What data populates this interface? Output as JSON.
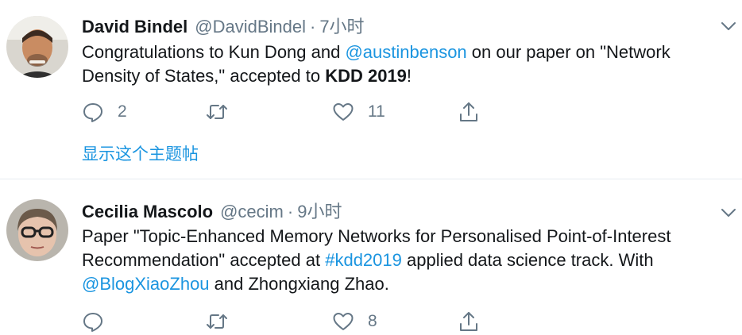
{
  "colors": {
    "link": "#1b95e0",
    "muted": "#657786",
    "text": "#14171a",
    "divider": "#e6ecf0"
  },
  "tweets": [
    {
      "name": "David Bindel",
      "handle": "@DavidBindel",
      "dot": "·",
      "time": "7小时",
      "text": {
        "p1": "Congratulations to Kun Dong and ",
        "mention": "@austinbenson",
        "p2": " on our paper on \"Network Density of States,\" accepted to ",
        "bold": "KDD 2019",
        "p3": "!"
      },
      "actions": {
        "reply_count": "2",
        "retweet_count": "",
        "like_count": "11"
      },
      "show_thread": "显示这个主题帖",
      "icons": {
        "reply": "reply-icon",
        "retweet": "retweet-icon",
        "like": "heart-icon",
        "share": "share-icon",
        "menu": "chevron-down-icon"
      }
    },
    {
      "name": "Cecilia Mascolo",
      "handle": "@cecim",
      "dot": "·",
      "time": "9小时",
      "text": {
        "p1": "Paper \"Topic-Enhanced Memory Networks for Personalised Point-of-Interest Recommendation\" accepted at ",
        "hashtag": "#kdd2019",
        "p2": " applied data science track. With ",
        "mention": "@BlogXiaoZhou",
        "p3": " and Zhongxiang Zhao."
      },
      "actions": {
        "reply_count": "",
        "retweet_count": "",
        "like_count": "8"
      },
      "icons": {
        "reply": "reply-icon",
        "retweet": "retweet-icon",
        "like": "heart-icon",
        "share": "share-icon",
        "menu": "chevron-down-icon"
      }
    }
  ]
}
